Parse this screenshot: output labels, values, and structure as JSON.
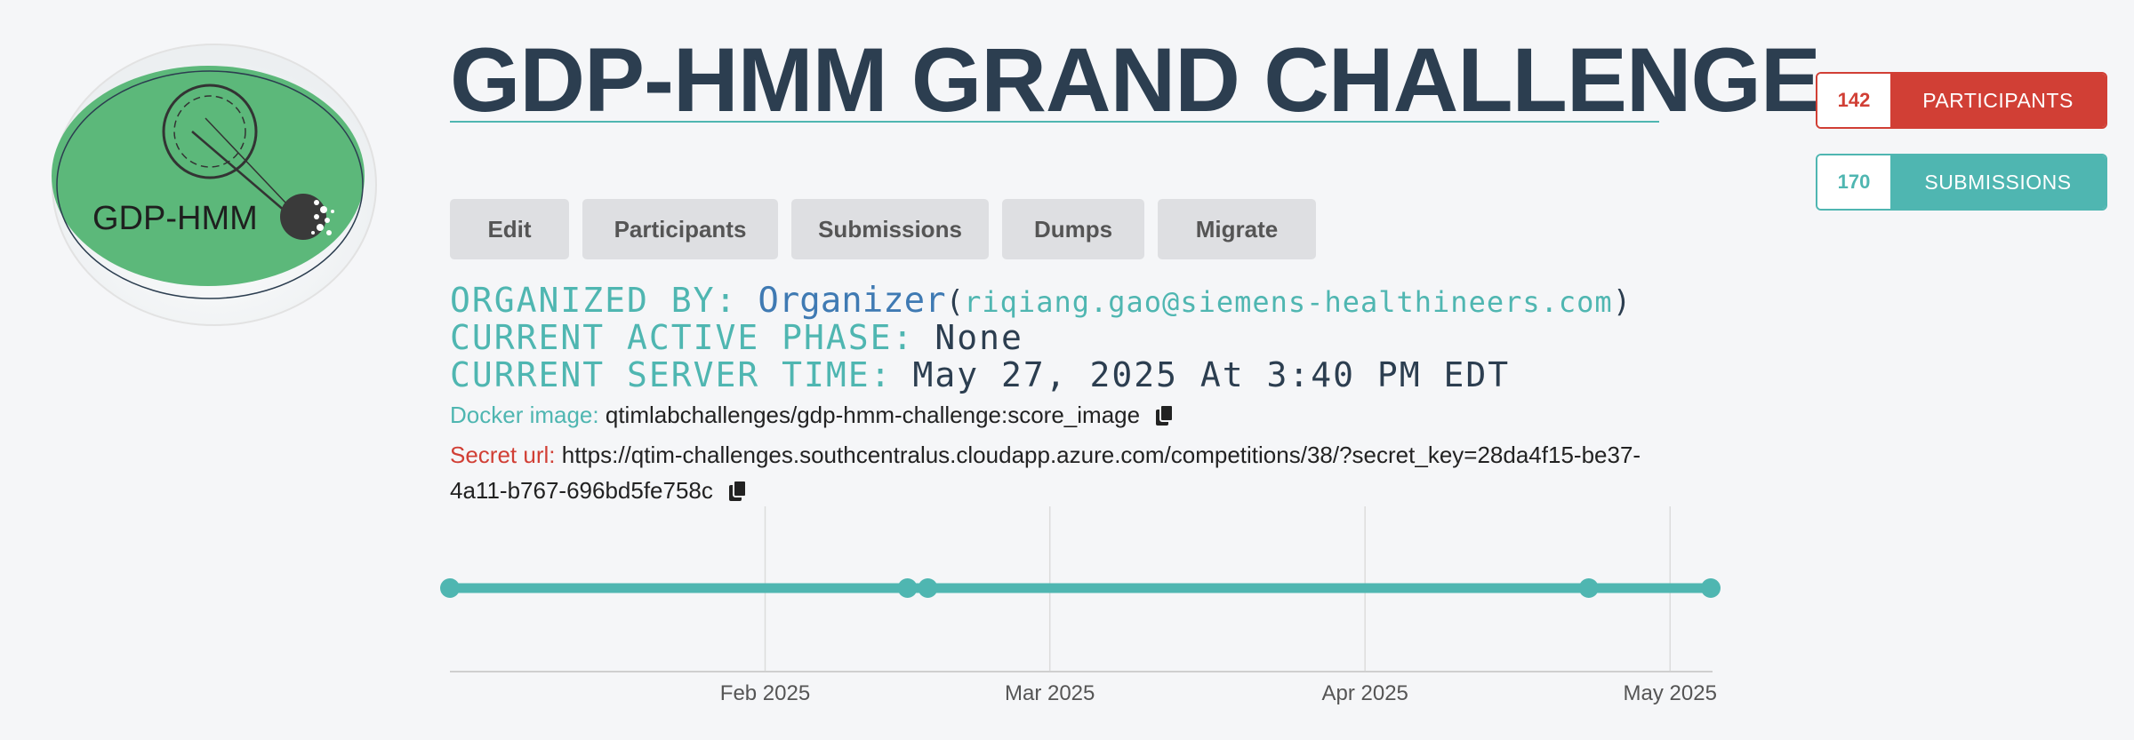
{
  "logo": {
    "text": "GDP-HMM"
  },
  "title": "GDP-HMM GRAND CHALLENGE",
  "stats": {
    "participants": {
      "count": "142",
      "label": "PARTICIPANTS",
      "color": "#d13f35"
    },
    "submissions": {
      "count": "170",
      "label": "SUBMISSIONS",
      "color": "#4fb6b1"
    }
  },
  "tabs": [
    "Edit",
    "Participants",
    "Submissions",
    "Dumps",
    "Migrate"
  ],
  "info": {
    "organized_by_label": "ORGANIZED BY:",
    "organizer": "Organizer",
    "organizer_email": "riqiang.gao@siemens-healthineers.com",
    "phase_label": "CURRENT ACTIVE PHASE:",
    "phase_value": "None",
    "time_label": "CURRENT SERVER TIME:",
    "time_value": "May 27, 2025 At 3:40 PM EDT"
  },
  "docker": {
    "label": "Docker image:",
    "value": "qtimlabchallenges/gdp-hmm-challenge:score_image"
  },
  "secret": {
    "label": "Secret url:",
    "value": "https://qtim-challenges.southcentralus.cloudapp.azure.com/competitions/38/?secret_key=28da4f15-be37-4a11-b767-696bd5fe758c"
  },
  "icons": {
    "copy": "copy-icon"
  },
  "chart_data": {
    "type": "line",
    "x_ticks": [
      "Feb 2025",
      "Mar 2025",
      "Apr 2025",
      "May 2025"
    ],
    "phase_points": [
      "2025-01-01",
      "2025-02-15",
      "2025-02-17",
      "2025-04-23",
      "2025-05-05"
    ],
    "xlim": [
      "2025-01-01",
      "2025-05-05"
    ],
    "color": "#4fb6b1"
  }
}
